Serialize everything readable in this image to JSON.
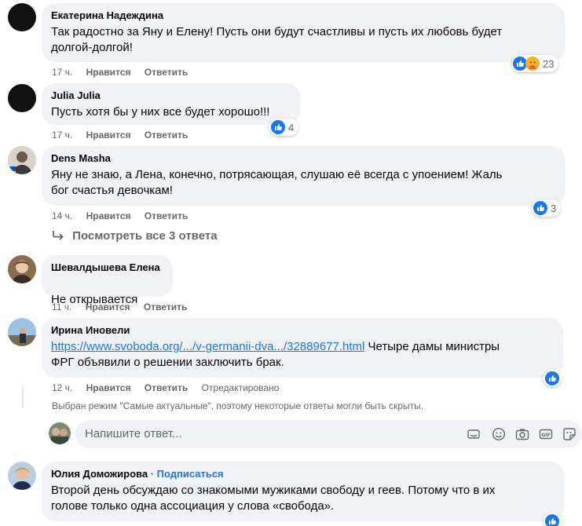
{
  "comments": [
    {
      "author": "Екатерина Надеждина",
      "text": "Так радостно за Яну и Елену! Пусть они будут счастливы и пусть их любовь будет\nдолгой-долгой!",
      "time": "17 ч.",
      "like": "Нравится",
      "reply": "Ответить",
      "reactions": "23"
    },
    {
      "author": "Julia Julia",
      "text": "Пусть хотя бы у них все будет хорошо!!!",
      "time": "17 ч.",
      "like": "Нравится",
      "reply": "Ответить",
      "reactions": "4"
    },
    {
      "author": "Dens Masha",
      "text": "Яну не знаю, а Лена, конечно, потрясающая, слушаю её всегда с упоением! Жаль\nбог счастья девочкам!",
      "time": "14 ч.",
      "like": "Нравится",
      "reply": "Ответить",
      "reactions": "3"
    }
  ],
  "view_replies": "Посмотреть все 3 ответа",
  "replies": [
    {
      "author": "Шевалдышева Елена",
      "text": "Не открывается",
      "time": "11 ч.",
      "like": "Нравится",
      "reply": "Ответить"
    },
    {
      "author": "Ирина Иновели",
      "link": "https://www.svoboda.org/.../v-germanii-dva.../32889677.html",
      "text_after_link": " Четыре дамы министры",
      "text_line2": "ФРГ объявили о решении заключить брак.",
      "time": "12 ч.",
      "like": "Нравится",
      "reply": "Ответить",
      "edited": "Отредактировано"
    }
  ],
  "notice": "Выбран режим \"Самые актуальные\", поэтому некоторые ответы могли быть скрыты.",
  "reply_input": {
    "placeholder": "Напишите ответ..."
  },
  "last_comment": {
    "author": "Юлия Доможирова",
    "separator": " · ",
    "subscribe": "Подписаться",
    "text": "Второй день обсуждаю со знакомыми мужиками свободу и геев. Потому что в их\nголове только одна ассоциация у слова «свобода»."
  },
  "colors": {
    "bubble": "#f0f2f5",
    "link": "#1877f2",
    "like_blue": "#1877f2",
    "meta_gray": "#65676b"
  },
  "icons": [
    "reply-arrow-icon",
    "like-reaction-icon",
    "care-reaction-icon",
    "sticker-icon",
    "emoji-icon",
    "camera-icon",
    "gif-icon",
    "sticker-face-icon"
  ]
}
